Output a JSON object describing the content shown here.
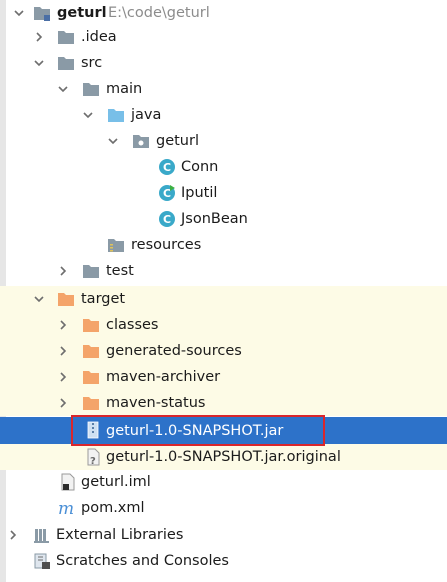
{
  "project": {
    "name": "geturl",
    "path": "E:\\code\\geturl"
  },
  "tree": {
    "idea": ".idea",
    "src": "src",
    "main": "main",
    "java": "java",
    "package": "geturl",
    "classes_list": [
      "Conn",
      "Iputil",
      "JsonBean"
    ],
    "resources": "resources",
    "test": "test",
    "target": "target",
    "target_children": [
      "classes",
      "generated-sources",
      "maven-archiver",
      "maven-status"
    ],
    "jar": "geturl-1.0-SNAPSHOT.jar",
    "jar_original": "geturl-1.0-SNAPSHOT.jar.original",
    "iml": "geturl.iml",
    "pom": "pom.xml",
    "external_libraries": "External Libraries",
    "scratches": "Scratches and Consoles"
  },
  "colors": {
    "selection": "#2d72c9",
    "excluded_background": "#fdfbe6",
    "highlight_box": "#d9262c",
    "folder": "#8a9aa6",
    "source_folder": "#78bfe8",
    "excluded_folder": "#f4a46a",
    "class_icon": "#3aa9c9"
  }
}
